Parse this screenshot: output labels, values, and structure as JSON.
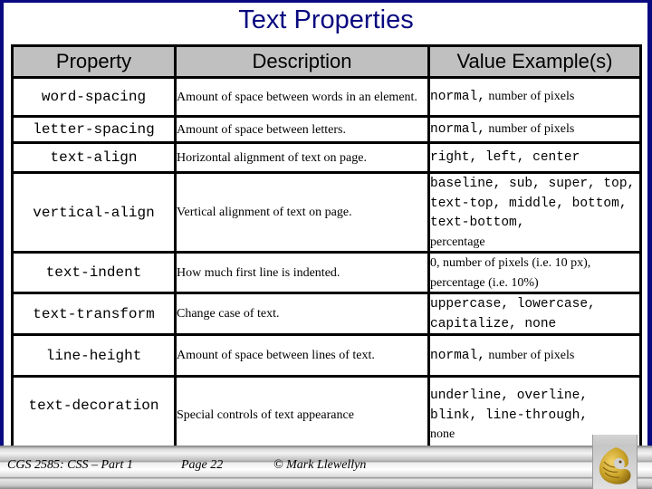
{
  "slide": {
    "title": "Text Properties"
  },
  "table": {
    "headers": [
      "Property",
      "Description",
      "Value Example(s)"
    ],
    "rows": [
      {
        "property": "word-spacing",
        "description": "Amount of space between words in an element.",
        "value_mono": "normal,",
        "value_serif": " number of pixels"
      },
      {
        "property": "letter-spacing",
        "description": "Amount of space between letters.",
        "value_mono": "normal,",
        "value_serif": " number of pixels"
      },
      {
        "property": "text-align",
        "description": "Horizontal alignment of text on page.",
        "value_mono": "right, left, center",
        "value_serif": ""
      },
      {
        "property": "vertical-align",
        "description": "Vertical alignment of text on page.",
        "value_mono": "baseline, sub, super, top, text-top, middle, bottom, text-bottom,",
        "value_serif": "percentage"
      },
      {
        "property": "text-indent",
        "description": "How much first line is indented.",
        "value_mono": "",
        "value_serif": "0, number of pixels (i.e. 10 px), percentage (i.e. 10%)"
      },
      {
        "property": "text-transform",
        "description": "Change case of text.",
        "value_mono": "uppercase, lowercase, capitalize, none",
        "value_serif": ""
      },
      {
        "property": "line-height",
        "description": "Amount of space between lines of text.",
        "value_mono": "normal,",
        "value_serif": " number of pixels"
      },
      {
        "property": "text-decoration",
        "description": "Special controls of text appearance",
        "value_mono": "underline, overline, blink, line-through,",
        "value_serif": "none"
      }
    ]
  },
  "footer": {
    "course": "CGS 2585: CSS – Part 1",
    "page": "Page 22",
    "copyright": "© Mark Llewellyn"
  },
  "logo": {
    "icon": "ucf-pegasus-logo",
    "color": "#c9a227"
  },
  "colors": {
    "title": "#0a0a80",
    "frame": "#0a0a80",
    "header_bg": "#c0c0c0"
  }
}
